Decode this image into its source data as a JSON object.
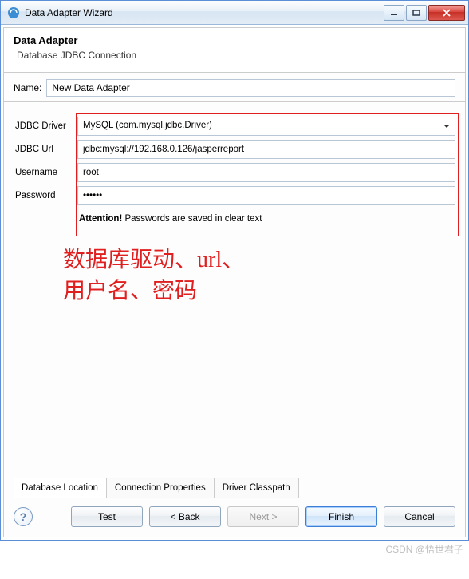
{
  "window": {
    "title": "Data Adapter Wizard"
  },
  "header": {
    "title": "Data Adapter",
    "subtitle": "Database JDBC Connection"
  },
  "name": {
    "label": "Name:",
    "value": "New Data Adapter"
  },
  "form": {
    "driver": {
      "label": "JDBC Driver",
      "value": "MySQL (com.mysql.jdbc.Driver)"
    },
    "url": {
      "label": "JDBC Url",
      "value": "jdbc:mysql://192.168.0.126/jasperreport"
    },
    "username": {
      "label": "Username",
      "value": "root"
    },
    "password": {
      "label": "Password",
      "value": "••••••"
    },
    "attention": {
      "bold": "Attention!",
      "text": " Passwords are saved in clear text"
    }
  },
  "annotation": "数据库驱动、url、\n用户名、密码",
  "tabs": {
    "t1": "Database Location",
    "t2": "Connection Properties",
    "t3": "Driver Classpath"
  },
  "buttons": {
    "test": "Test",
    "back": "< Back",
    "next": "Next >",
    "finish": "Finish",
    "cancel": "Cancel"
  },
  "watermark": "CSDN @悟世君子"
}
